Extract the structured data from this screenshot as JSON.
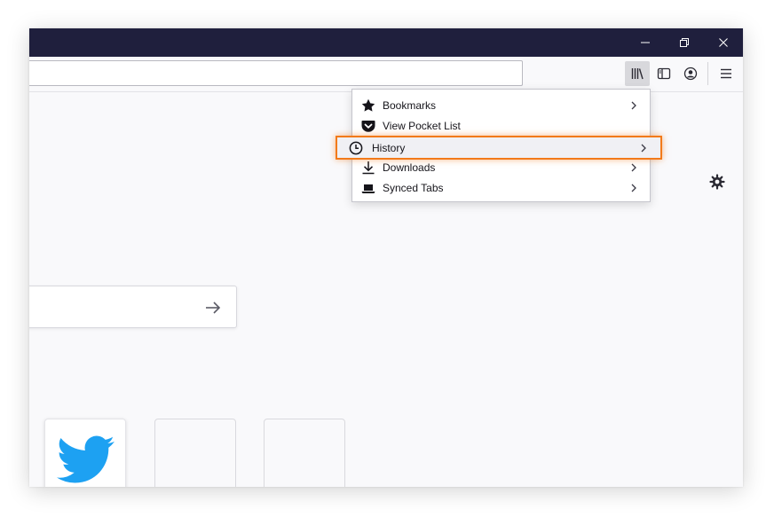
{
  "library_menu": {
    "items": [
      {
        "label": "Bookmarks",
        "icon": "star-icon",
        "has_submenu": true
      },
      {
        "label": "View Pocket List",
        "icon": "pocket-icon",
        "has_submenu": false
      },
      {
        "label": "History",
        "icon": "clock-icon",
        "has_submenu": true,
        "highlighted": true
      },
      {
        "label": "Downloads",
        "icon": "download-icon",
        "has_submenu": true
      },
      {
        "label": "Synced Tabs",
        "icon": "laptop-icon",
        "has_submenu": true
      }
    ]
  },
  "new_tab": {
    "top_sites": [
      {
        "label": "twitter",
        "icon": "twitter-bird-icon"
      },
      {
        "label": "",
        "icon": ""
      },
      {
        "label": "",
        "icon": ""
      }
    ]
  },
  "colors": {
    "titlebar": "#1f1f3d",
    "highlight_outline": "#f27a1a",
    "twitter_blue": "#1da1f2"
  }
}
